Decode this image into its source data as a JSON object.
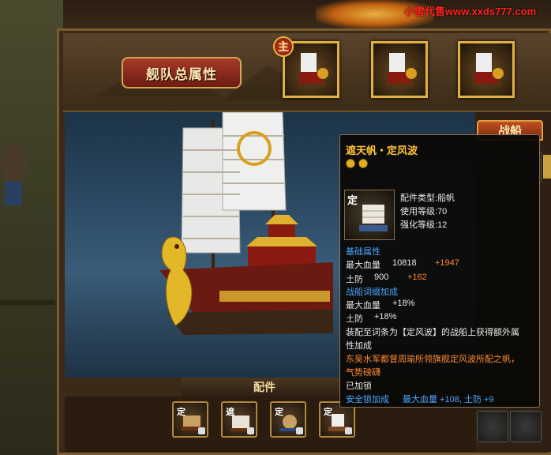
{
  "watermark": "小雪代售www.xxds777.com",
  "fleet": {
    "attributes_button": "舰队总属性",
    "main_badge": "主"
  },
  "accessories": {
    "title": "配件",
    "slots": [
      {
        "mark": "定",
        "locked": true
      },
      {
        "mark": "遮",
        "locked": true
      },
      {
        "mark": "定",
        "locked": true
      },
      {
        "mark": "定",
        "locked": true
      }
    ]
  },
  "right_panel": {
    "tab_label": "战船"
  },
  "tooltip": {
    "title": "遮天帆・定风波",
    "icon_mark": "定",
    "type_label": "配件类型:",
    "type_value": "船帆",
    "use_level_label": "使用等级:",
    "use_level_value": "70",
    "enhance_level_label": "强化等级:",
    "enhance_level_value": "12",
    "base_attr_header": "基础属性",
    "max_hp_label": "最大血量",
    "max_hp_value": "10818",
    "max_hp_bonus": "+1947",
    "earth_def_label": "土防",
    "earth_def_value": "900",
    "earth_def_bonus": "+162",
    "affix_header": "战船词缀加成",
    "affix_hp_label": "最大血量",
    "affix_hp_value": "+18%",
    "affix_def_label": "土防",
    "affix_def_value": "+18%",
    "set_desc_1": "装配至词条为【定风波】的战船上获得额外属",
    "set_desc_2": "性加成",
    "lore_1": "东吴水军都督周瑜所领旗舰定风波所配之帆，",
    "lore_2": "气势磅礴",
    "locked_text": "已加锁",
    "safety_lock_label": "安全锁加成",
    "safety_lock_value": "最大血量 +108, 土防 +9"
  },
  "colors": {
    "title_gold": "#ffc038",
    "bonus_orange": "#ff8a30",
    "header_blue": "#4aa8ff",
    "lore_orange": "#ff8a30"
  }
}
